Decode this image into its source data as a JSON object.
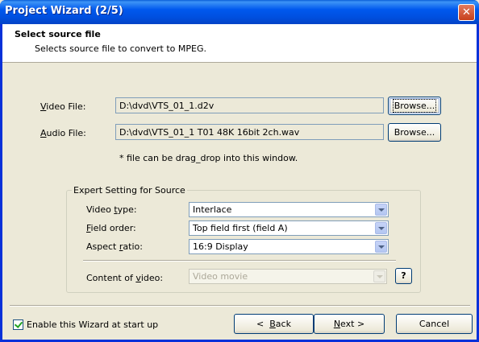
{
  "window": {
    "title": "Project Wizard (2/5)"
  },
  "header": {
    "title": "Select source file",
    "subtitle": "Selects source file to convert to MPEG."
  },
  "source": {
    "video_label_pre": "",
    "video_label_ul": "V",
    "video_label_post": "ideo File:",
    "video_value": "D:\\dvd\\VTS_01_1.d2v",
    "audio_label_ul": "A",
    "audio_label_post": "udio File:",
    "audio_value": "D:\\dvd\\VTS_01_1 T01 48K 16bit 2ch.wav",
    "browse_label": "Browse...",
    "hint": "* file can be drag_drop into this window."
  },
  "expert": {
    "group_title": "Expert Setting for Source",
    "video_type": {
      "label_pre": "Video ",
      "label_ul": "t",
      "label_post": "ype:",
      "value": "Interlace"
    },
    "field_order": {
      "label_ul": "F",
      "label_post": "ield order:",
      "value": "Top field first (field A)"
    },
    "aspect_ratio": {
      "label_pre": "Aspect ",
      "label_ul": "r",
      "label_post": "atio:",
      "value": "16:9 Display"
    },
    "content": {
      "label_pre": "Content of ",
      "label_ul": "v",
      "label_post": "ideo:",
      "value": "Video movie"
    },
    "help_label": "?"
  },
  "footer": {
    "enable_wizard_label": "Enable this Wizard at start up",
    "enable_wizard_checked": true,
    "back_arrow": "<",
    "back_ul": "B",
    "back_post": "ack",
    "next_ul": "N",
    "next_post": "ext",
    "next_arrow": ">",
    "cancel_label": "Cancel"
  },
  "colors": {
    "titlebar": "#0058ee",
    "window_bg": "#ece9d8",
    "border": "#0831d9"
  }
}
